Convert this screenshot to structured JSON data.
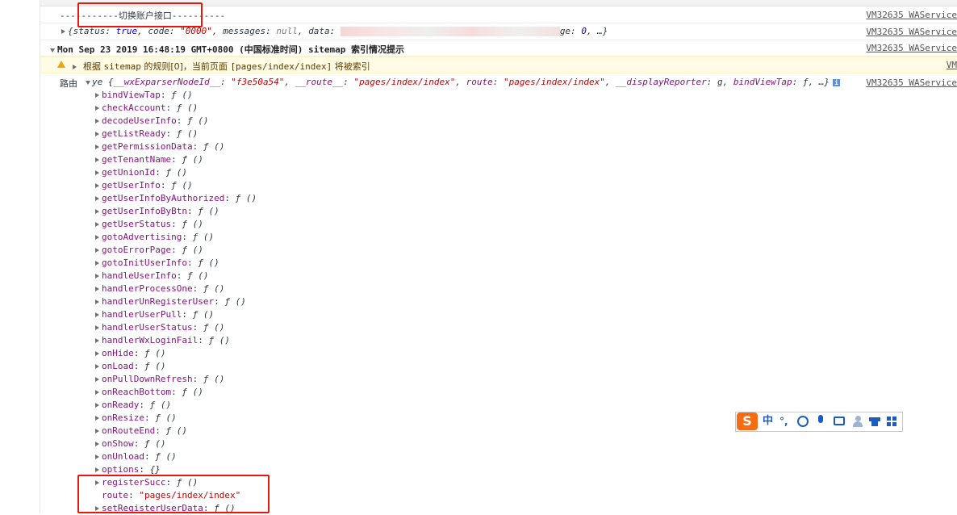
{
  "log1": {
    "text": "-----------切换账户接口----------",
    "source": "VM32635 WAService"
  },
  "log2": {
    "prefix": "{status: ",
    "status": "true",
    "code_key": ", code: ",
    "code": "\"0000\"",
    "messages_key": ", messages: ",
    "messages": "null",
    "data_key": ", data: ",
    "tail_key": "ge: ",
    "tail_val": "0",
    "tail_end": ", …}",
    "source": "VM32635 WAService"
  },
  "log3": {
    "text": "Mon Sep 23 2019 16:48:19 GMT+0800 (中国标准时间) sitemap 索引情况提示",
    "source": "VM32635 WAService"
  },
  "warning": {
    "prefix": "根据 ",
    "code1": "sitemap",
    "mid": " 的规则[0]，当前页面 ",
    "code2": "[pages/index/index]",
    "suffix": " 将被索引",
    "source": "VM"
  },
  "route_log": {
    "label": "路由",
    "obj_name": "ye",
    "k1": "__wxExparserNodeId__",
    "v1": "\"f3e50a54\"",
    "k2": "__route__",
    "v2": "\"pages/index/index\"",
    "k3": "route",
    "v3": "\"pages/index/index\"",
    "k4": "__displayReporter",
    "v4": "g",
    "k5": "bindViewTap",
    "v5": "ƒ",
    "end": ", …}",
    "info": "i",
    "source": "VM32635 WAService"
  },
  "props": [
    {
      "key": "bindViewTap",
      "val": "ƒ ()"
    },
    {
      "key": "checkAccount",
      "val": "ƒ ()"
    },
    {
      "key": "decodeUserInfo",
      "val": "ƒ ()"
    },
    {
      "key": "getListReady",
      "val": "ƒ ()"
    },
    {
      "key": "getPermissionData",
      "val": "ƒ ()"
    },
    {
      "key": "getTenantName",
      "val": "ƒ ()"
    },
    {
      "key": "getUnionId",
      "val": "ƒ ()"
    },
    {
      "key": "getUserInfo",
      "val": "ƒ ()"
    },
    {
      "key": "getUserInfoByAuthorized",
      "val": "ƒ ()"
    },
    {
      "key": "getUserInfoByBtn",
      "val": "ƒ ()"
    },
    {
      "key": "getUserStatus",
      "val": "ƒ ()"
    },
    {
      "key": "gotoAdvertising",
      "val": "ƒ ()"
    },
    {
      "key": "gotoErrorPage",
      "val": "ƒ ()"
    },
    {
      "key": "gotoInitUserInfo",
      "val": "ƒ ()"
    },
    {
      "key": "handleUserInfo",
      "val": "ƒ ()"
    },
    {
      "key": "handlerProcessOne",
      "val": "ƒ ()"
    },
    {
      "key": "handlerUnRegisterUser",
      "val": "ƒ ()"
    },
    {
      "key": "handlerUserPull",
      "val": "ƒ ()"
    },
    {
      "key": "handlerUserStatus",
      "val": "ƒ ()"
    },
    {
      "key": "handlerWxLoginFail",
      "val": "ƒ ()"
    },
    {
      "key": "onHide",
      "val": "ƒ ()"
    },
    {
      "key": "onLoad",
      "val": "ƒ ()"
    },
    {
      "key": "onPullDownRefresh",
      "val": "ƒ ()"
    },
    {
      "key": "onReachBottom",
      "val": "ƒ ()"
    },
    {
      "key": "onReady",
      "val": "ƒ ()"
    },
    {
      "key": "onResize",
      "val": "ƒ ()"
    },
    {
      "key": "onRouteEnd",
      "val": "ƒ ()"
    },
    {
      "key": "onShow",
      "val": "ƒ ()"
    },
    {
      "key": "onUnload",
      "val": "ƒ ()"
    },
    {
      "key": "options",
      "val": "{}"
    },
    {
      "key": "registerSucc",
      "val": "ƒ ()"
    },
    {
      "key": "route",
      "val": "\"pages/index/index\"",
      "string": true,
      "no_toggle": true
    },
    {
      "key": "setRegisterUserData",
      "val": "ƒ ()"
    }
  ],
  "ime_toolbar": {
    "logo": "S",
    "lang": "中",
    "punct": "°,",
    "icons": [
      "smiley-icon",
      "mic-icon",
      "keyboard-icon",
      "user-icon",
      "shirt-icon",
      "grid-icon"
    ]
  },
  "colors": {
    "highlight_box": "#e8160c",
    "warning_bg": "#fffbe5",
    "string": "#c80000",
    "property": "#881280",
    "ime_accent": "#1a5cc2",
    "ime_logo": "#f56c14"
  }
}
